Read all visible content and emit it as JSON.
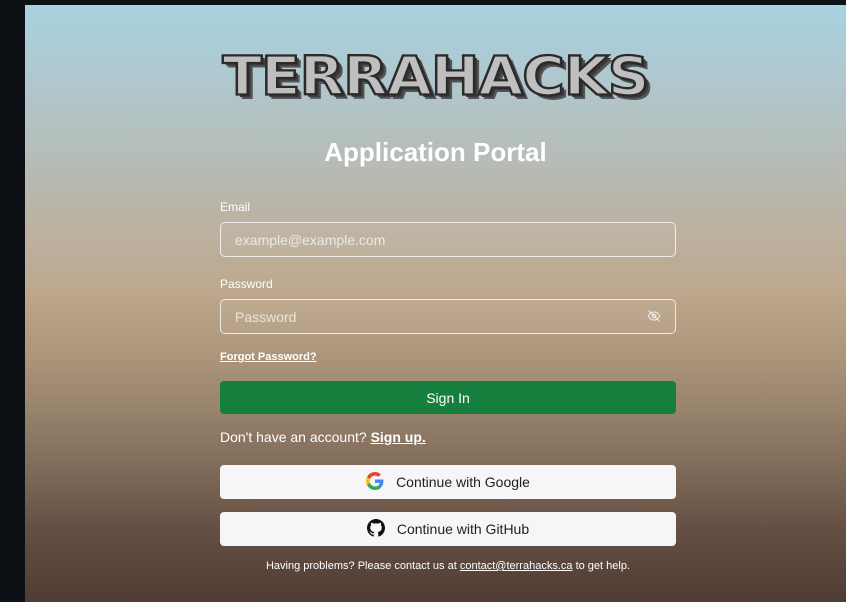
{
  "brand": {
    "logo_text": "TERRAHACKS"
  },
  "page": {
    "title": "Application Portal"
  },
  "form": {
    "email_label": "Email",
    "email_placeholder": "example@example.com",
    "password_label": "Password",
    "password_placeholder": "Password",
    "forgot_link": "Forgot Password?",
    "signin_label": "Sign In",
    "no_account_text": "Don't have an account?",
    "signup_link": "Sign up."
  },
  "oauth": {
    "google_label": "Continue with Google",
    "github_label": "Continue with GitHub",
    "google_icon": "google-g-icon",
    "github_icon": "github-octocat-icon"
  },
  "help": {
    "prefix": "Having problems? Please contact us at",
    "email": "contact@terrahacks.ca",
    "suffix": "to get help."
  },
  "colors": {
    "primary_button": "#15803d",
    "oauth_button_bg": "#f6f6f8",
    "text": "#ffffff"
  }
}
